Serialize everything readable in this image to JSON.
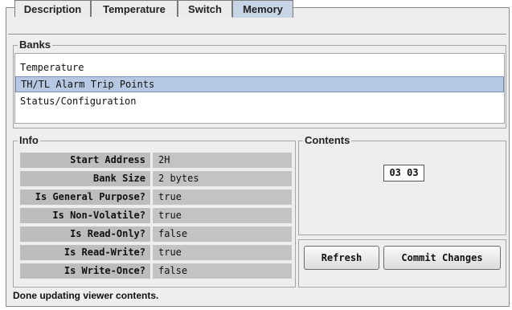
{
  "tabs": [
    "Description",
    "Temperature",
    "Switch",
    "Memory"
  ],
  "active_tab": "Memory",
  "banks": {
    "title": "Banks",
    "items": [
      "Temperature",
      "TH/TL Alarm Trip Points",
      "Status/Configuration"
    ],
    "selected": "TH/TL Alarm Trip Points"
  },
  "info": {
    "title": "Info",
    "rows": [
      {
        "label": "Start Address",
        "value": "2H"
      },
      {
        "label": "Bank Size",
        "value": "2 bytes"
      },
      {
        "label": "Is General Purpose?",
        "value": "true"
      },
      {
        "label": "Is Non-Volatile?",
        "value": "true"
      },
      {
        "label": "Is Read-Only?",
        "value": "false"
      },
      {
        "label": "Is Read-Write?",
        "value": "true"
      },
      {
        "label": "Is Write-Once?",
        "value": "false"
      }
    ]
  },
  "contents": {
    "title": "Contents",
    "value": "03 03"
  },
  "buttons": {
    "refresh": "Refresh",
    "commit": "Commit Changes"
  },
  "status": "Done updating viewer contents.",
  "colors": {
    "active_tab": "#c7d4e6",
    "selection": "#b7c8e2"
  }
}
